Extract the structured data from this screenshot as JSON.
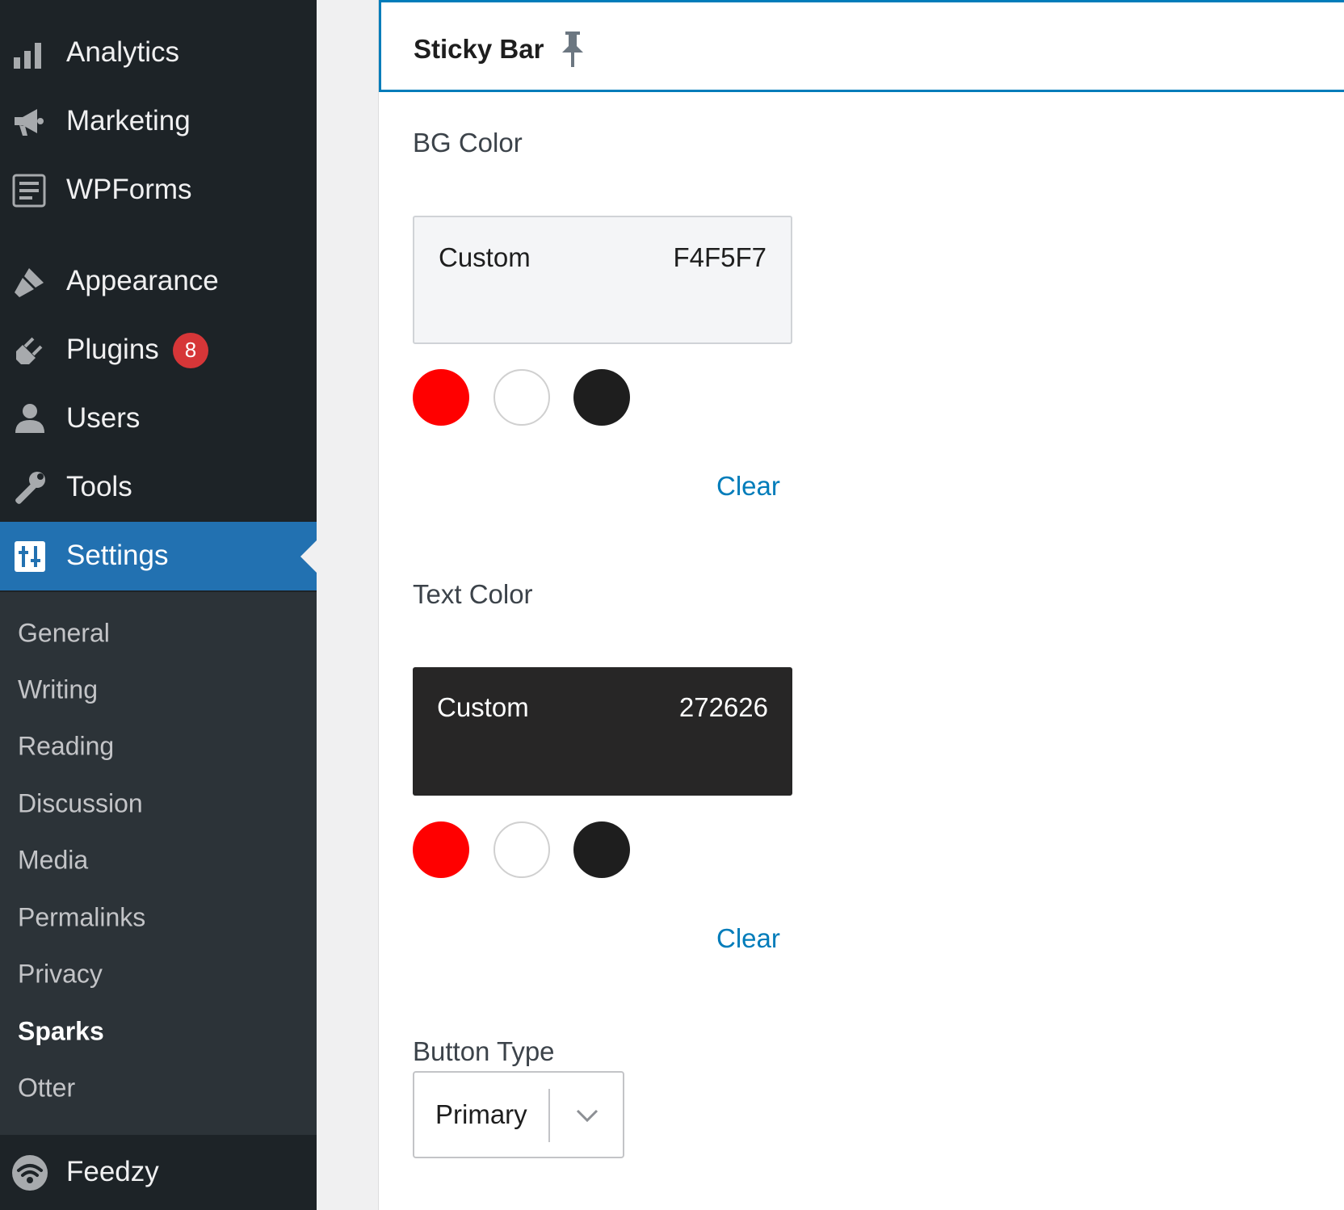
{
  "sidebar": {
    "menu": [
      {
        "label": "Analytics",
        "icon": "bar-chart-icon"
      },
      {
        "label": "Marketing",
        "icon": "megaphone-icon"
      },
      {
        "label": "WPForms",
        "icon": "form-icon"
      },
      {
        "label": "Appearance",
        "icon": "paintbrush-icon"
      },
      {
        "label": "Plugins",
        "icon": "plugin-icon",
        "badge": "8"
      },
      {
        "label": "Users",
        "icon": "user-icon"
      },
      {
        "label": "Tools",
        "icon": "wrench-icon"
      },
      {
        "label": "Settings",
        "icon": "settings-icon",
        "current": true
      }
    ],
    "submenu": [
      "General",
      "Writing",
      "Reading",
      "Discussion",
      "Media",
      "Permalinks",
      "Privacy",
      "Sparks",
      "Otter"
    ],
    "submenu_active": "Sparks",
    "footer_item": {
      "label": "Feedzy",
      "icon": "feedzy-wifi-icon"
    }
  },
  "panel": {
    "title": "Sticky Bar",
    "title_icon": "pin-icon",
    "bg_color": {
      "label": "BG Color",
      "custom_label": "Custom",
      "custom_value": "F4F5F7",
      "swatches": [
        "#ff0000",
        "#ffffff",
        "#1e1e1e"
      ],
      "clear_label": "Clear"
    },
    "text_color": {
      "label": "Text Color",
      "custom_label": "Custom",
      "custom_value": "272626",
      "swatches": [
        "#ff0000",
        "#ffffff",
        "#1e1e1e"
      ],
      "clear_label": "Clear"
    },
    "button_type": {
      "label": "Button Type",
      "value": "Primary"
    }
  },
  "colors": {
    "sidebar_bg": "#1d2327",
    "submenu_bg": "#2c3338",
    "accent": "#2271b1",
    "link": "#007cba",
    "badge": "#d63638",
    "bg_preview": "#f4f5f7",
    "text_preview": "#272626"
  }
}
